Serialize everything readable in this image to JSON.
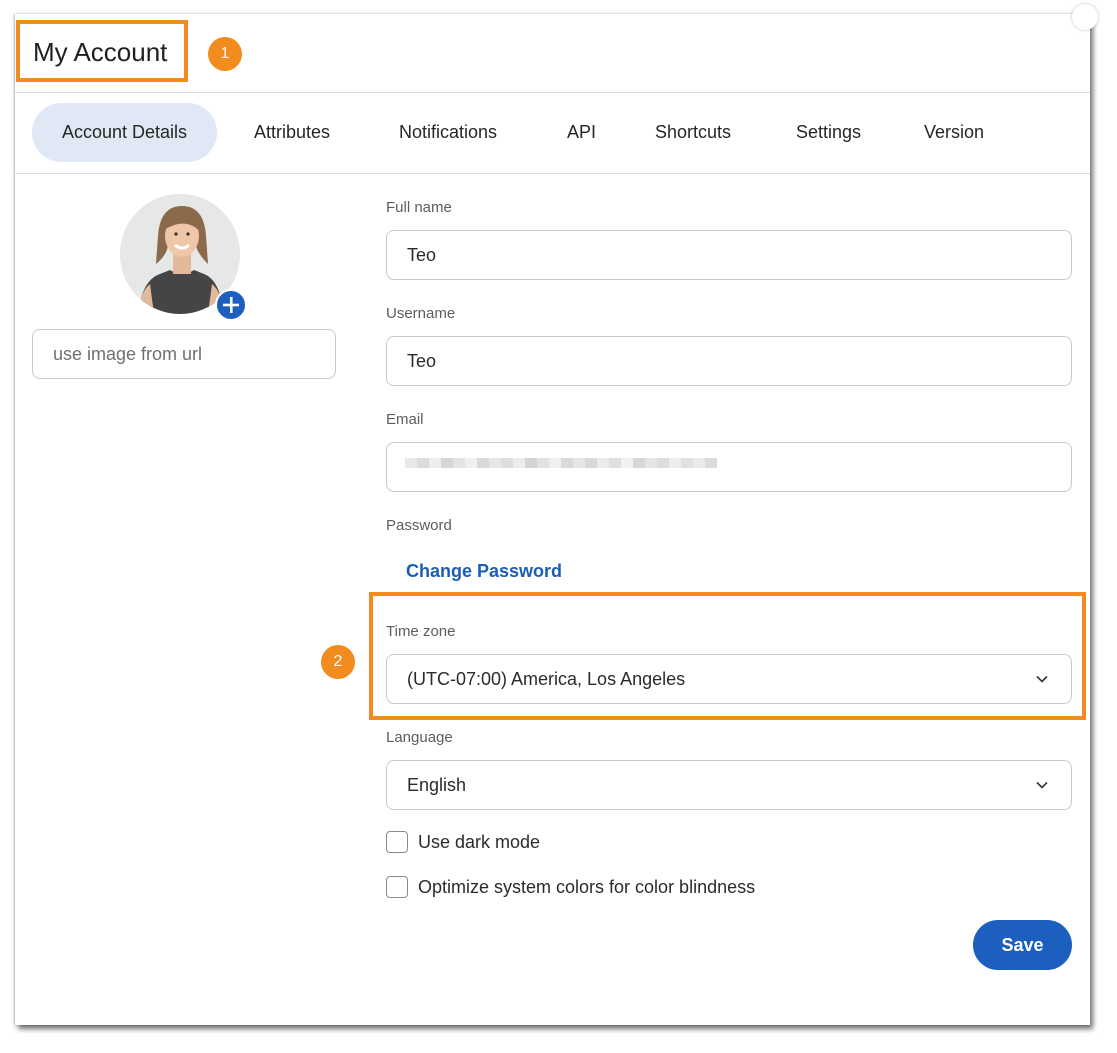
{
  "dialog": {
    "title": "My Account",
    "callouts": [
      "1",
      "2"
    ]
  },
  "tabs": [
    {
      "label": "Account Details",
      "active": true
    },
    {
      "label": "Attributes",
      "active": false
    },
    {
      "label": "Notifications",
      "active": false
    },
    {
      "label": "API",
      "active": false
    },
    {
      "label": "Shortcuts",
      "active": false
    },
    {
      "label": "Settings",
      "active": false
    },
    {
      "label": "Version",
      "active": false
    }
  ],
  "avatar": {
    "add_icon": "plus-icon",
    "url_placeholder": "use image from url"
  },
  "form": {
    "full_name_label": "Full name",
    "full_name_value": "Teo",
    "username_label": "Username",
    "username_value": "Teo",
    "email_label": "Email",
    "email_value": "",
    "password_label": "Password",
    "change_password_link": "Change Password",
    "timezone_label": "Time zone",
    "timezone_value": "(UTC-07:00) America, Los Angeles",
    "language_label": "Language",
    "language_value": "English",
    "dark_mode_label": "Use dark mode",
    "dark_mode_checked": false,
    "color_blind_label": "Optimize system colors for color blindness",
    "color_blind_checked": false,
    "save_label": "Save"
  },
  "colors": {
    "accent": "#1c5fbf",
    "highlight": "#f28c1e",
    "active_tab_bg": "#dfe8f4"
  }
}
